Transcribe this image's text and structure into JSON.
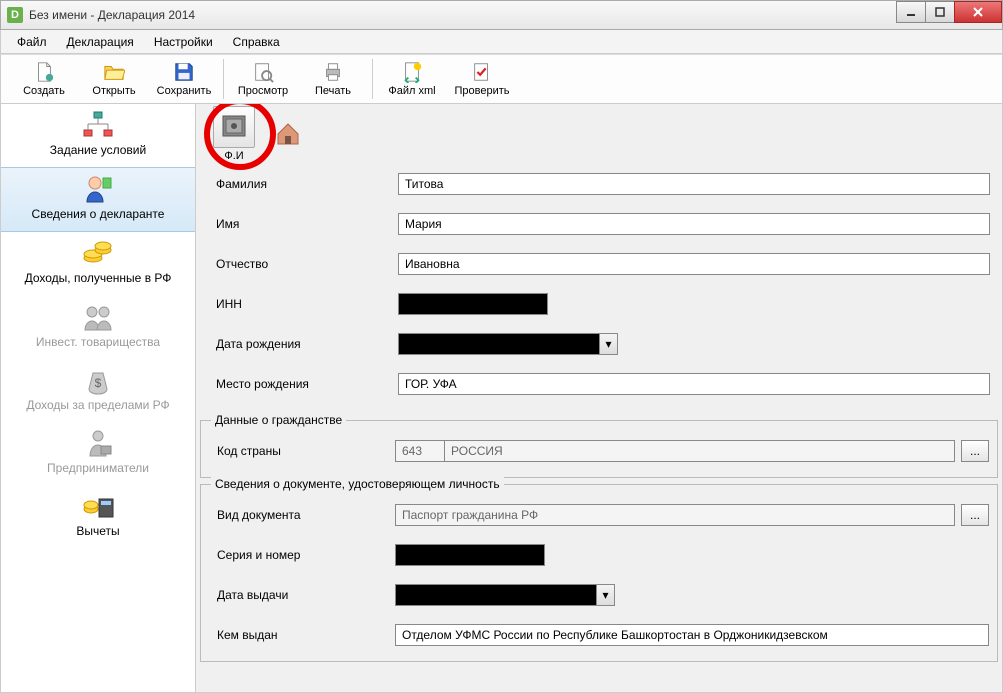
{
  "window": {
    "title": "Без имени - Декларация 2014",
    "app_icon": "D"
  },
  "menu": {
    "file": "Файл",
    "decl": "Декларация",
    "settings": "Настройки",
    "help": "Справка"
  },
  "toolbar": {
    "create": "Создать",
    "open": "Открыть",
    "save": "Сохранить",
    "preview": "Просмотр",
    "print": "Печать",
    "xml": "Файл xml",
    "check": "Проверить"
  },
  "sidebar": {
    "s0": "Задание условий",
    "s1": "Сведения о декларанте",
    "s2": "Доходы, полученные в РФ",
    "s3": "Инвест. товарищества",
    "s4": "Доходы за пределами РФ",
    "s5": "Предприниматели",
    "s6": "Вычеты"
  },
  "subtoolbar": {
    "fio": "Ф.И"
  },
  "form": {
    "surname_lbl": "Фамилия",
    "surname_val": "Титова",
    "name_lbl": "Имя",
    "name_val": "Мария",
    "patronymic_lbl": "Отчество",
    "patronymic_val": "Ивановна",
    "inn_lbl": "ИНН",
    "inn_val": "████████████",
    "dob_lbl": "Дата рождения",
    "dob_val": "██.██.████",
    "pob_lbl": "Место рождения",
    "pob_val": "ГОР. УФА"
  },
  "citizenship": {
    "legend": "Данные о гражданстве",
    "code_lbl": "Код страны",
    "code_val": "643",
    "name_val": "РОССИЯ"
  },
  "identity": {
    "legend": "Сведения о документе, удостоверяющем личность",
    "doctype_lbl": "Вид документа",
    "doctype_val": "Паспорт гражданина РФ",
    "serial_lbl": "Серия и номер",
    "serial_val": "████ ██████",
    "issuedate_lbl": "Дата выдачи",
    "issuedate_val": "██.██.████",
    "issuedby_lbl": "Кем выдан",
    "issuedby_val": "Отделом УФМС России по Республике Башкортостан в Орджоникидзевском"
  },
  "ellipsis": "..."
}
